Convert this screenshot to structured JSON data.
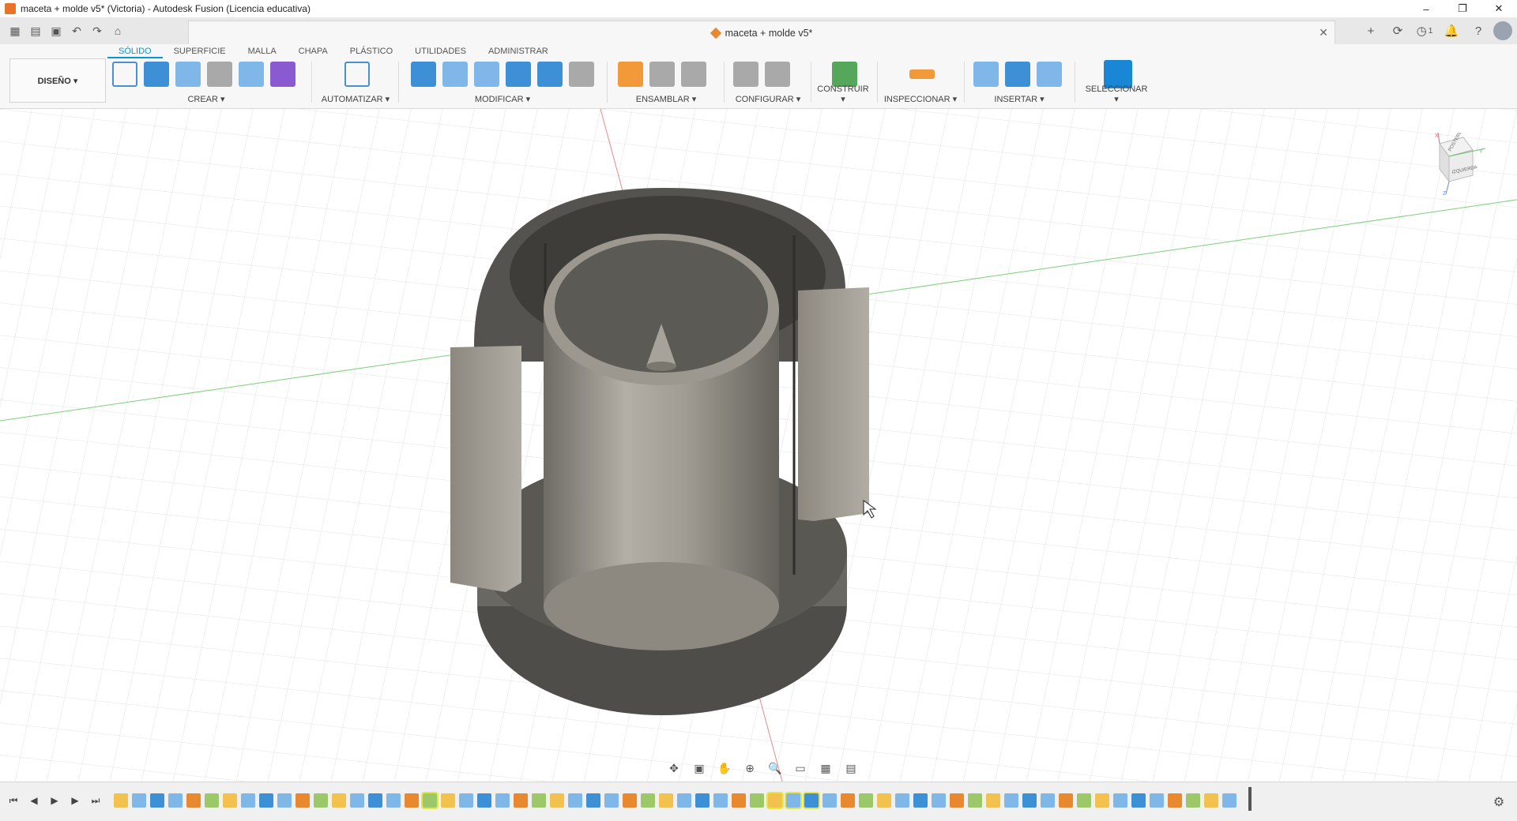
{
  "window": {
    "title": "maceta + molde v5* (Victoria) - Autodesk Fusion (Licencia educativa)",
    "minimize": "–",
    "restore": "❐",
    "close": "✕"
  },
  "document": {
    "tab_title": "maceta + molde v5*",
    "close_glyph": "✕"
  },
  "quick_access": [
    {
      "name": "apps-grid-icon",
      "glyph": "▦"
    },
    {
      "name": "file-menu-icon",
      "glyph": "▤"
    },
    {
      "name": "save-icon",
      "glyph": "▣"
    },
    {
      "name": "undo-icon",
      "glyph": "↶"
    },
    {
      "name": "redo-icon",
      "glyph": "↷"
    },
    {
      "name": "home-icon",
      "glyph": "⌂"
    }
  ],
  "right_icons": [
    {
      "name": "new-tab-icon",
      "glyph": "+"
    },
    {
      "name": "extensions-icon",
      "glyph": "⟳"
    },
    {
      "name": "job-status-icon",
      "glyph": "◷",
      "count": "1"
    },
    {
      "name": "notifications-icon",
      "glyph": "🔔"
    },
    {
      "name": "help-icon",
      "glyph": "?"
    }
  ],
  "ribbon": {
    "workspace": "DISEÑO ▾",
    "tabs": [
      "SÓLIDO",
      "SUPERFICIE",
      "MALLA",
      "CHAPA",
      "PLÁSTICO",
      "UTILIDADES",
      "ADMINISTRAR"
    ],
    "active_tab": "SÓLIDO",
    "groups": [
      {
        "label": "CREAR ▾"
      },
      {
        "label": "AUTOMATIZAR ▾"
      },
      {
        "label": "MODIFICAR ▾"
      },
      {
        "label": "ENSAMBLAR ▾"
      },
      {
        "label": "CONFIGURAR ▾"
      },
      {
        "label": "CONSTRUIR ▾"
      },
      {
        "label": "INSPECCIONAR ▾"
      },
      {
        "label": "INSERTAR ▾"
      },
      {
        "label": "SELECCIONAR ▾"
      }
    ]
  },
  "viewcube": {
    "faces": [
      "POSTERIOR",
      "IZQUIERDA"
    ],
    "axes": [
      "X",
      "Y",
      "Z"
    ]
  },
  "navbar": [
    {
      "name": "orbit-icon",
      "glyph": "✥"
    },
    {
      "name": "look-at-icon",
      "glyph": "▣"
    },
    {
      "name": "pan-icon",
      "glyph": "✋"
    },
    {
      "name": "zoom-icon",
      "glyph": "⊕"
    },
    {
      "name": "fit-icon",
      "glyph": "🔍"
    },
    {
      "name": "display-settings-icon",
      "glyph": "▭"
    },
    {
      "name": "grid-settings-icon",
      "glyph": "▦"
    },
    {
      "name": "viewports-icon",
      "glyph": "▤"
    }
  ],
  "timeline": {
    "controls": [
      "⏮",
      "◀",
      "▶",
      "▶",
      "⏭"
    ],
    "gear_glyph": "⚙"
  },
  "colors": {
    "accent": "#0696d7",
    "model_dark": "#5e5c57",
    "model_light": "#a9a59c"
  }
}
